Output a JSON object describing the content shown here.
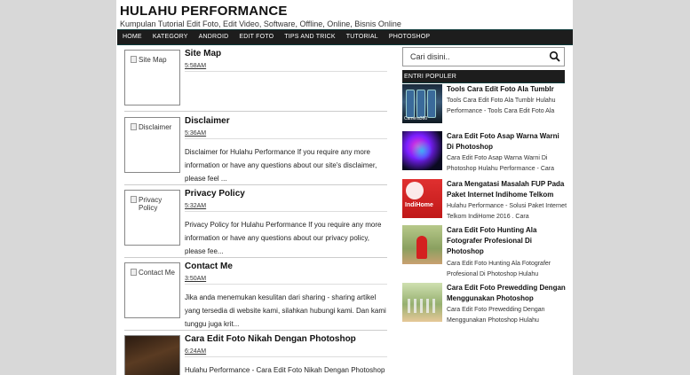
{
  "header": {
    "title": "HULAHU PERFORMANCE",
    "description": "Kumpulan Tutorial Edit Foto, Edit Video, Software, Offline, Online, Bisnis Online"
  },
  "nav": [
    {
      "label": "HOME"
    },
    {
      "label": "KATEGORY"
    },
    {
      "label": "ANDROID"
    },
    {
      "label": "EDIT FOTO"
    },
    {
      "label": "TIPS AND TRICK"
    },
    {
      "label": "TUTORIAL"
    },
    {
      "label": "PHOTOSHOP"
    }
  ],
  "posts": [
    {
      "title": "Site Map",
      "time": "5:58AM",
      "thumb_alt": "Site Map",
      "snippet": ""
    },
    {
      "title": "Disclaimer",
      "time": "5:36AM",
      "thumb_alt": "Disclaimer",
      "snippet": "Disclaimer for Hulahu Performance If you require any more information or have any questions about our site's disclaimer, please feel ..."
    },
    {
      "title": "Privacy Policy",
      "time": "5:32AM",
      "thumb_alt": "Privacy Policy",
      "snippet": "Privacy Policy for Hulahu Performance If you require any more information or have any questions about our privacy policy, please fee..."
    },
    {
      "title": "Contact Me",
      "time": "3:50AM",
      "thumb_alt": "Contact Me",
      "snippet": "Jika anda menemukan kesulitan dari sharing - sharing artikel yang tersedia di website kami, silahkan hubungi kami. Dan kami tunggu juga krit..."
    },
    {
      "title": "Cara Edit Foto Nikah Dengan Photoshop",
      "time": "6:24AM",
      "thumb_alt": "",
      "snippet": "Hulahu Performance - Cara Edit Foto Nikah Dengan Photoshop"
    }
  ],
  "search": {
    "placeholder": "Cari disini.."
  },
  "popular": {
    "title": "ENTRI POPULER",
    "items": [
      {
        "title": "Tools Cara Edit Foto Ala Tumblr",
        "snippet": "Tools Cara Edit Foto Ala Tumblr Hulahu Performance - Tools Cara Edit Foto Ala",
        "thumb_text": "Camera360"
      },
      {
        "title": "Cara Edit Foto Asap Warna Warni Di Photoshop",
        "snippet": "Cara Edit Foto Asap Warna Warni Di Photoshop Hulahu Performance - Cara",
        "thumb_text": ""
      },
      {
        "title": "Cara Mengatasi Masalah FUP Pada Paket Internet Indihome Telkom",
        "snippet": "Hulahu Performance - Solusi Paket Internet Telkom IndiHome 2016 . Cara",
        "thumb_text": "IndiHome"
      },
      {
        "title": "Cara Edit Foto Hunting Ala Fotografer Profesional Di Photoshop",
        "snippet": "Cara Edit Foto Hunting Ala Fotografer Profesional Di Photoshop Hulahu",
        "thumb_text": ""
      },
      {
        "title": "Cara Edit Foto Prewedding Dengan Menggunakan Photoshop",
        "snippet": "Cara Edit Foto Prewedding Dengan Menggunakan Photoshop Hulahu",
        "thumb_text": ""
      }
    ]
  }
}
